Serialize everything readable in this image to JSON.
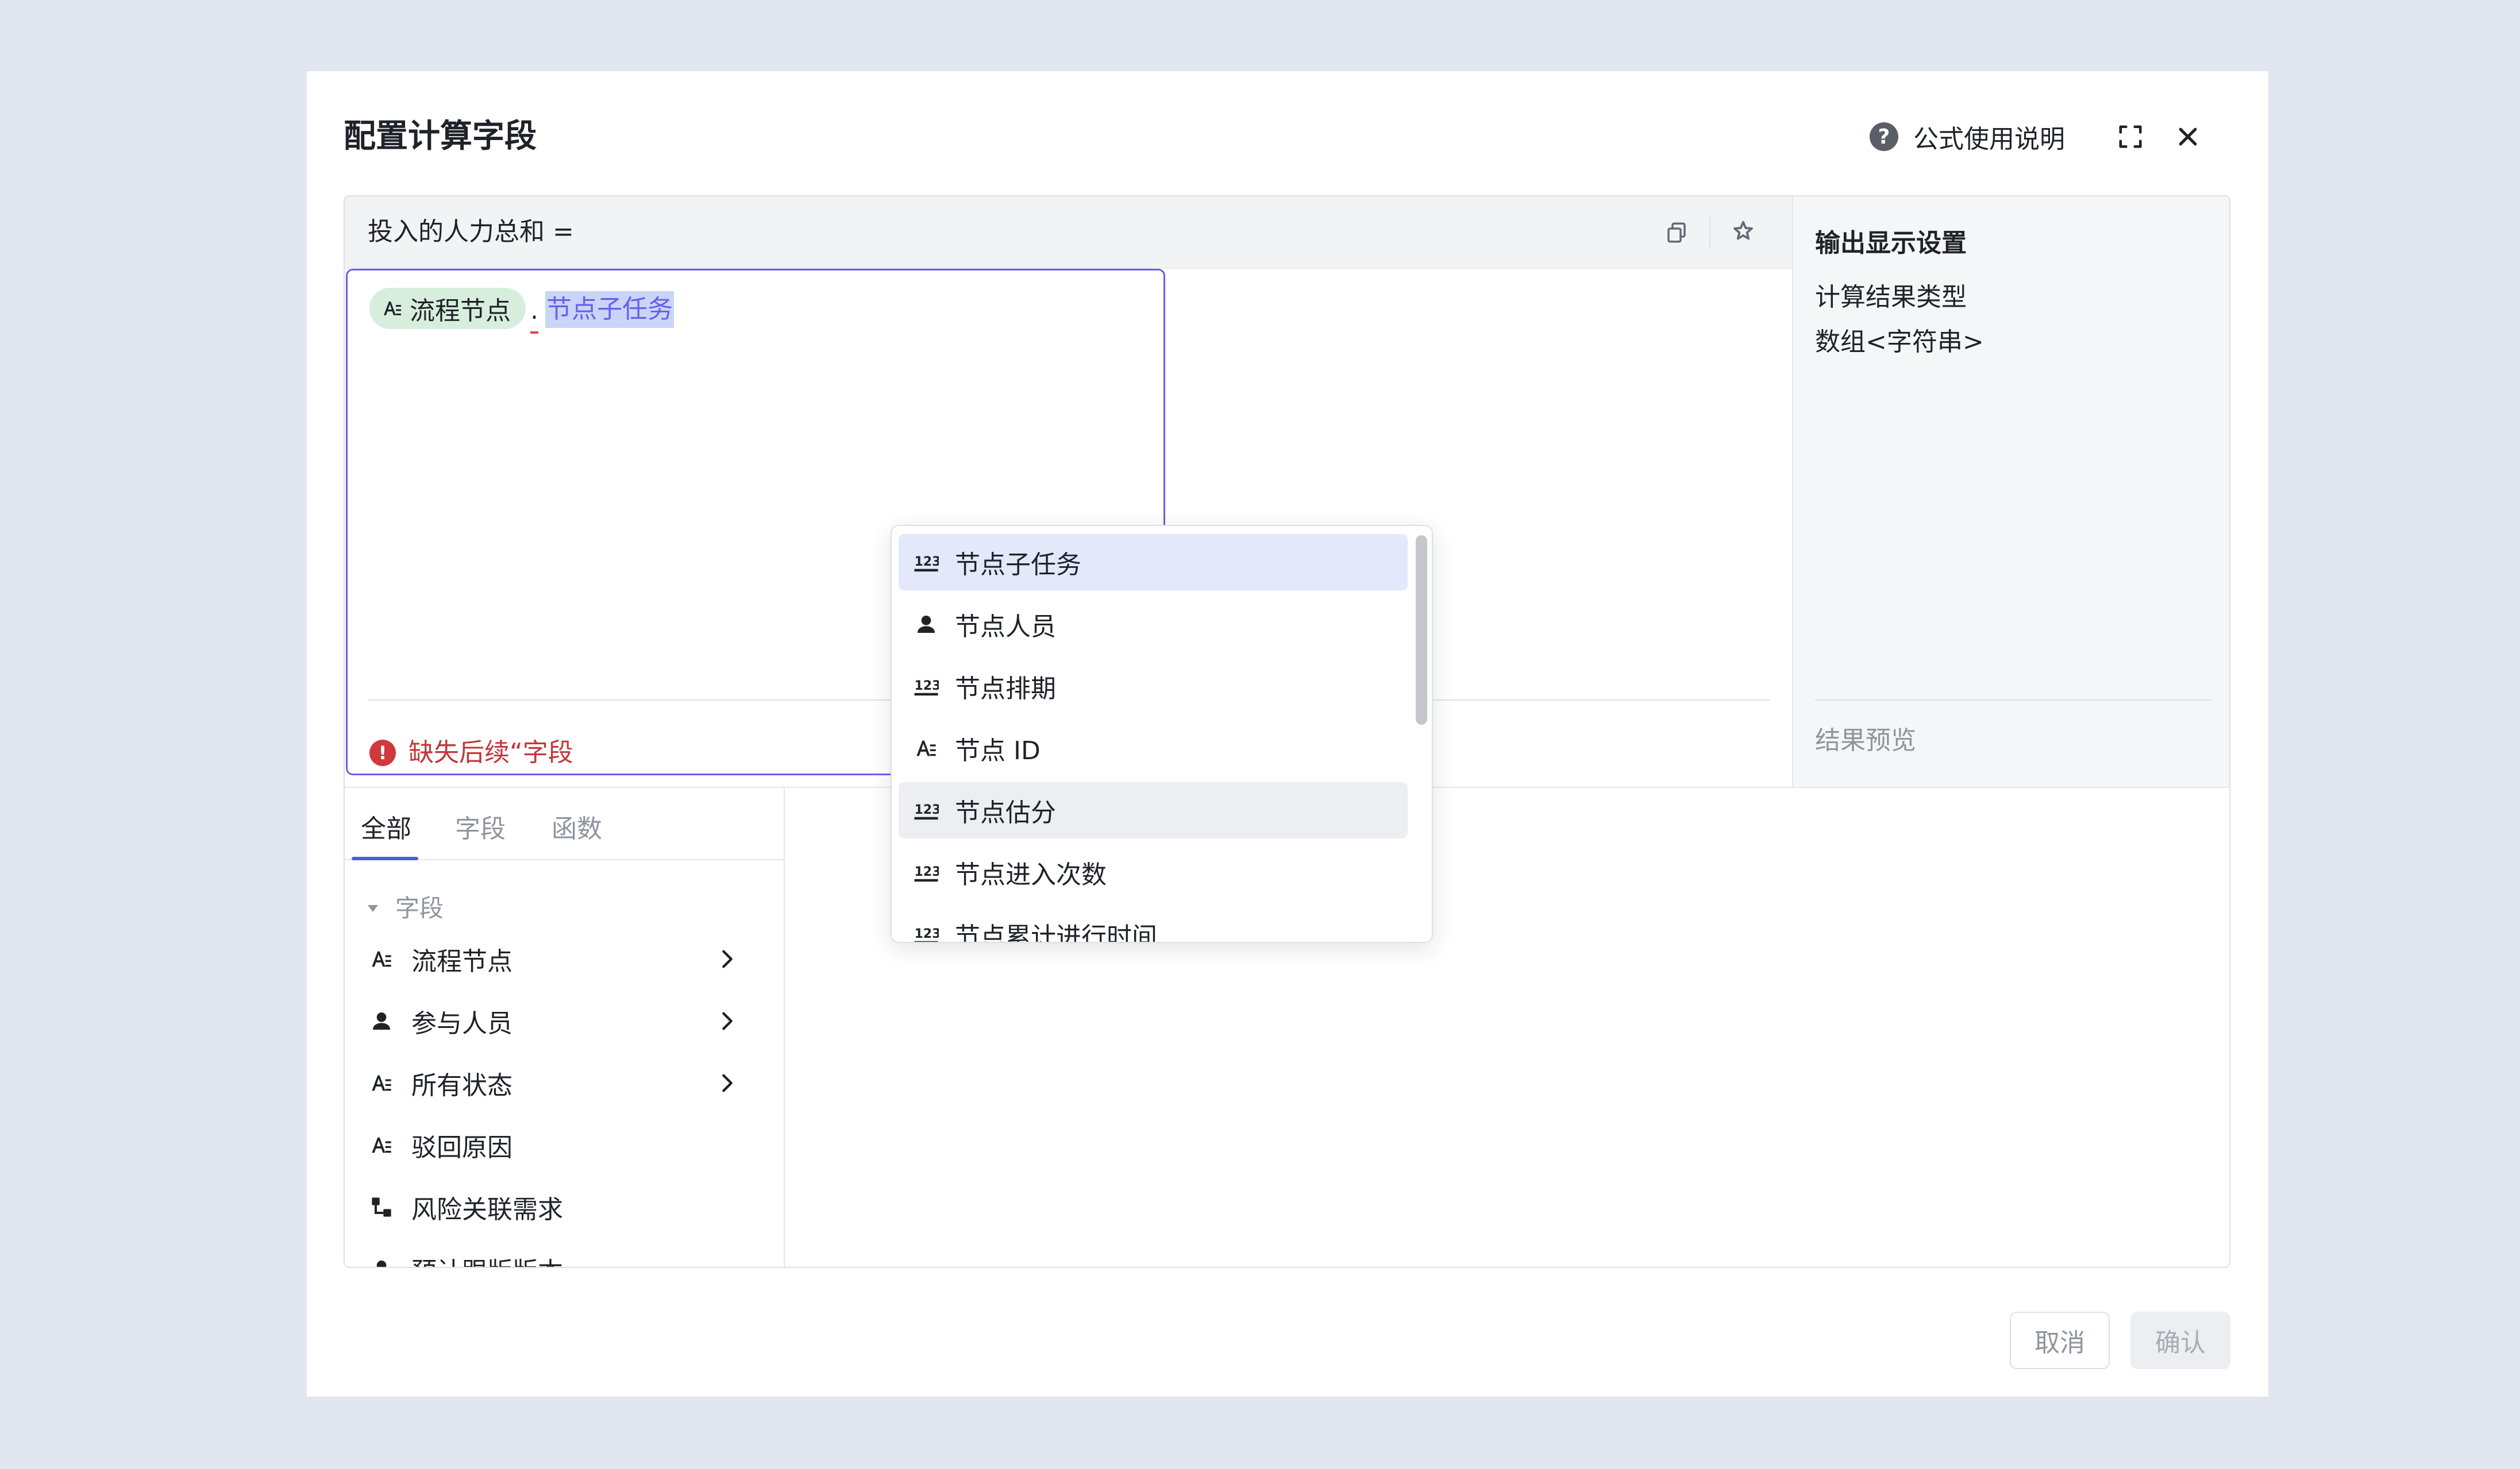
{
  "modal": {
    "title": "配置计算字段",
    "help_label": "公式使用说明",
    "help_icon_glyph": "?"
  },
  "formula": {
    "field_name": "投入的人力总和 =",
    "chip_label": "流程节点",
    "separator": ".",
    "typed_text": "节点子任务",
    "error_glyph": "!",
    "error_text": "缺失后续“字段"
  },
  "result": {
    "title": "输出显示设置",
    "type_label": "计算结果类型",
    "type_value": "数组<字符串>",
    "preview_label": "结果预览"
  },
  "dropdown": {
    "items": [
      {
        "label": "节点子任务",
        "icon": "number-icon",
        "state": "selected"
      },
      {
        "label": "节点人员",
        "icon": "person-icon",
        "state": ""
      },
      {
        "label": "节点排期",
        "icon": "number-icon",
        "state": ""
      },
      {
        "label": "节点 ID",
        "icon": "text-icon",
        "state": ""
      },
      {
        "label": "节点估分",
        "icon": "number-icon",
        "state": "hover"
      },
      {
        "label": "节点进入次数",
        "icon": "number-icon",
        "state": ""
      },
      {
        "label": "节点累计进行时间",
        "icon": "number-icon",
        "state": ""
      }
    ]
  },
  "list": {
    "tabs": [
      "全部",
      "字段",
      "函数"
    ],
    "active_tab": "全部",
    "group_label": "字段",
    "items": [
      {
        "label": "流程节点",
        "icon": "text-icon",
        "has_children": true
      },
      {
        "label": "参与人员",
        "icon": "person-icon",
        "has_children": true
      },
      {
        "label": "所有状态",
        "icon": "text-icon",
        "has_children": true
      },
      {
        "label": "驳回原因",
        "icon": "text-icon",
        "has_children": false
      },
      {
        "label": "风险关联需求",
        "icon": "relation-icon",
        "has_children": false
      },
      {
        "label": "预计跟版版本",
        "icon": "person-icon",
        "has_children": false
      }
    ]
  },
  "footer": {
    "cancel_label": "取消",
    "confirm_label": "确认"
  },
  "colors": {
    "accent": "#6b5df0",
    "tab_underline": "#4c5fd6",
    "error": "#c4363a",
    "chip_bg": "#d8eedd",
    "selected_bg": "#e3e8fb"
  }
}
